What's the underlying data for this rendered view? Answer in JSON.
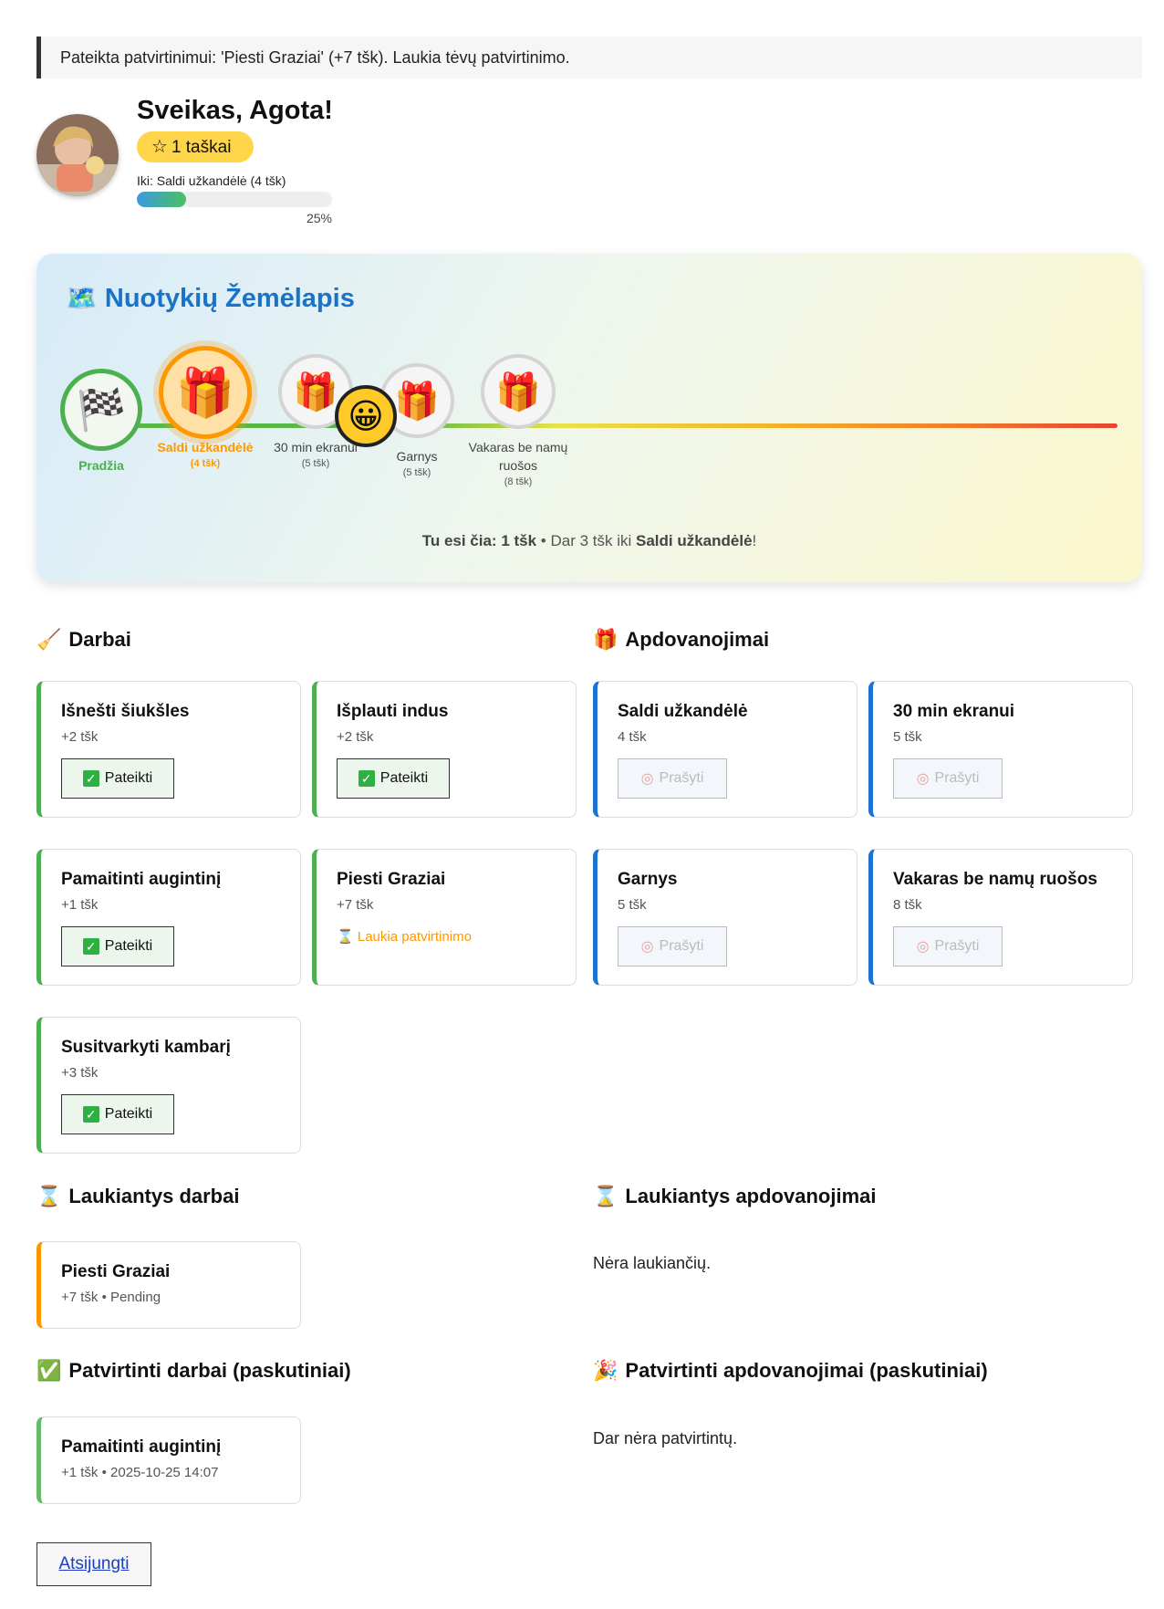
{
  "flash": "Pateikta patvirtinimui: 'Piesti Graziai' (+7 tšk). Laukia tėvų patvirtinimo.",
  "profile": {
    "greeting": "Sveikas, Agota!",
    "points_label": "1 taškai",
    "progress_label": "Iki: Saldi užkandėlė (4 tšk)",
    "progress_percent": 25,
    "progress_text": "25%"
  },
  "map": {
    "title": "Nuotykių Žemėlapis",
    "start_label": "Pradžia",
    "nodes": [
      {
        "name": "Saldi užkandėlė",
        "points": "(4 tšk)",
        "state": "active"
      },
      {
        "name": "30 min ekranui",
        "points": "(5 tšk)",
        "state": "locked"
      },
      {
        "name": "Garnys",
        "points": "(5 tšk)",
        "state": "locked"
      },
      {
        "name": "Vakaras be namų ruošos",
        "points": "(8 tšk)",
        "state": "locked"
      }
    ],
    "status_prefix": "Tu esi čia: 1 tšk",
    "status_mid": " • Dar 3 tšk iki ",
    "status_target": "Saldi užkandėlė",
    "status_suffix": "!"
  },
  "chores": {
    "title": "Darbai",
    "submit_label": "Pateikti",
    "waiting_label": "Laukia patvirtinimo",
    "items": [
      {
        "title": "Išnešti šiukšles",
        "points": "+2 tšk"
      },
      {
        "title": "Išplauti indus",
        "points": "+2 tšk"
      },
      {
        "title": "Pamaitinti augintinį",
        "points": "+1 tšk"
      },
      {
        "title": "Piesti Graziai",
        "points": "+7 tšk"
      },
      {
        "title": "Susitvarkyti kambarį",
        "points": "+3 tšk"
      }
    ]
  },
  "rewards": {
    "title": "Apdovanojimai",
    "request_label": "Prašyti",
    "items": [
      {
        "title": "Saldi užkandėlė",
        "points": "4 tšk"
      },
      {
        "title": "30 min ekranui",
        "points": "5 tšk"
      },
      {
        "title": "Garnys",
        "points": "5 tšk"
      },
      {
        "title": "Vakaras be namų ruošos",
        "points": "8 tšk"
      }
    ]
  },
  "pending_chores": {
    "title": "Laukiantys darbai",
    "items": [
      {
        "title": "Piesti Graziai",
        "meta": "+7 tšk • Pending"
      }
    ]
  },
  "pending_rewards": {
    "title": "Laukiantys apdovanojimai",
    "empty": "Nėra laukiančių."
  },
  "approved_chores": {
    "title": "Patvirtinti darbai (paskutiniai)",
    "items": [
      {
        "title": "Pamaitinti augintinį",
        "meta": "+1 tšk • 2025-10-25 14:07"
      }
    ]
  },
  "approved_rewards": {
    "title": "Patvirtinti apdovanojimai (paskutiniai)",
    "empty": "Dar nėra patvirtintų."
  },
  "logout_label": "Atsijungti"
}
